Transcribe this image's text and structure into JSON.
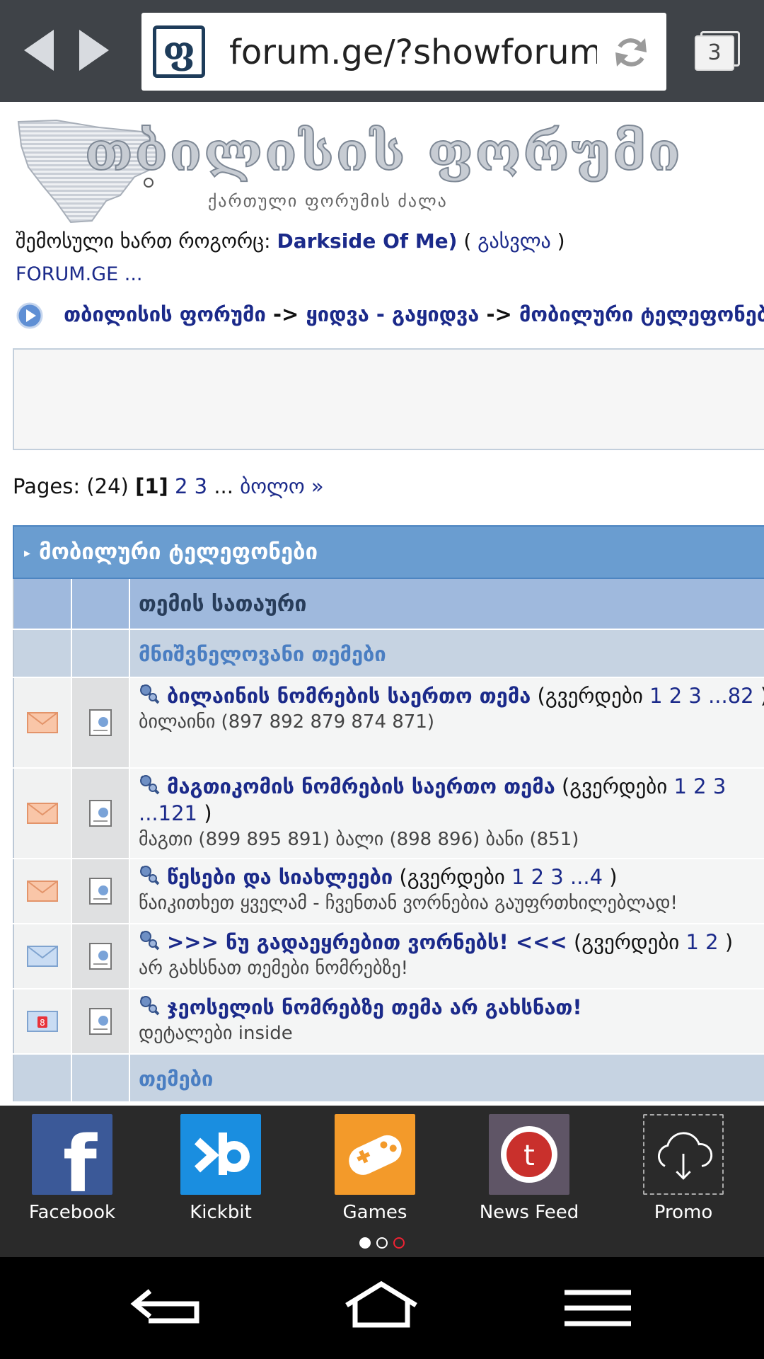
{
  "browser": {
    "url": "forum.ge/?showforum",
    "site_icon_glyph": "ფ",
    "tab_count": "3"
  },
  "logo": {
    "title": "თბილისის ფორუმი",
    "subtitle": "ქართული ფორუმის ძალა"
  },
  "session": {
    "prefix": "შემოსული ხართ როგორც:",
    "username": "Darkside Of Me)",
    "open_paren": "(",
    "logout": "გასვლა",
    "close_paren": ")"
  },
  "forum_link": "FORUM.GE ...",
  "breadcrumb": {
    "items": [
      "თბილისის ფორუმი",
      "ყიდვა - გაყიდვა",
      "მობილური ტელეფონები"
    ],
    "separator": "->"
  },
  "pagination": {
    "label": "Pages:",
    "total": "(24)",
    "current": "[1]",
    "pages": [
      "2",
      "3"
    ],
    "ellipsis": "...",
    "last": "ბოლო »"
  },
  "forum_table": {
    "title": "მობილური ტელეფონები",
    "column_topic": "თემის სათაური",
    "section_important": "მნიშვნელოვანი თემები",
    "section_topics": "თემები",
    "topics": [
      {
        "title": "ბილაინის ნომრების საერთო თემა",
        "pages_label": "(გვერდები",
        "pages": "1 2 3 ...82",
        "pages_close": ")",
        "description": "ბილაინი (897 892 879 874 871)",
        "status_icon": "envelope-orange"
      },
      {
        "title": "მაგთიკომის ნომრების საერთო თემა",
        "pages_label": "(გვერდები",
        "pages": "1 2 3 ...121",
        "pages_close": ")",
        "description": "მაგთი (899 895 891) ბალი (898 896) ბანი (851)",
        "status_icon": "envelope-orange"
      },
      {
        "title": "წესები და სიახლეები",
        "pages_label": "(გვერდები",
        "pages": "1 2 3 ...4",
        "pages_close": ")",
        "description": "წაიკითხეთ ყველამ - ჩვენთან ვორნებია გაუფრთხილებლად!",
        "status_icon": "envelope-orange"
      },
      {
        "title": ">>> ნუ გადაეყრებით ვორნებს! <<<",
        "pages_label": "(გვერდები",
        "pages": "1 2",
        "pages_close": ")",
        "description": "არ გახსნათ თემები ნომრებზე!",
        "status_icon": "envelope-blue"
      },
      {
        "title": "ჯეოსელის ნომრებზე თემა არ გახსნათ!",
        "pages_label": "",
        "pages": "",
        "pages_close": "",
        "description": "დეტალები inside",
        "status_icon": "envelope-locked"
      }
    ]
  },
  "dock": {
    "apps": [
      {
        "label": "Facebook",
        "color": "#3b5998"
      },
      {
        "label": "Kickbit",
        "color": "#1a8ee0"
      },
      {
        "label": "Games",
        "color": "#f39a2a"
      },
      {
        "label": "News Feed",
        "color": "#5f5566"
      },
      {
        "label": "Promo",
        "color": "#2a2a2a"
      }
    ],
    "page_indicator": {
      "pages": 3,
      "active": 1
    }
  },
  "colors": {
    "link": "#1b2a8a",
    "header_blue": "#6a9dd0",
    "browser_bar": "#3f4348"
  }
}
